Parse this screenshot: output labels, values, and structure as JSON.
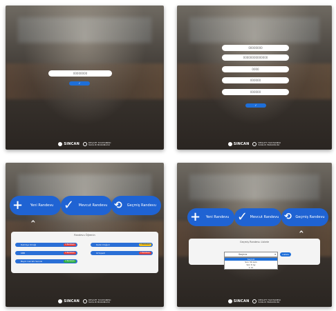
{
  "panel1": {
    "field_value": "00000000",
    "submit_label": "✓"
  },
  "panel2": {
    "fields": [
      "00000000",
      "00000000000000",
      "0000",
      "000000",
      "000000"
    ],
    "submit_label": "✓"
  },
  "panel3": {
    "new_label": "Yeni Randevu",
    "current_label": "Mevcut Randevu",
    "past_label": "Geçmiş Randevu",
    "card_title": "Randevu Öğrenin",
    "departments": [
      {
        "name": "Dahiliye Kliniği",
        "badge": "1 Randevu",
        "badge_color": "#e04040"
      },
      {
        "name": "Kadın Doğum",
        "badge": "1 Randevu",
        "badge_color": "#f0c020"
      },
      {
        "name": "KBB",
        "badge": "1 Randevu",
        "badge_color": "#e04040"
      },
      {
        "name": "Ortopedi",
        "badge": "1 Randevu",
        "badge_color": "#e04040"
      },
      {
        "name": "Beyin Cerrahi Servisi",
        "badge": "1 Randevu",
        "badge_color": "#30b040"
      }
    ]
  },
  "panel4": {
    "new_label": "Yeni Randevu",
    "current_label": "Mevcut Randevu",
    "past_label": "Geçmiş Randevu",
    "card_title": "Geçmiş Randevu Listele",
    "select_value": "Seçiniz",
    "options": [
      "Seçiniz",
      "Son 30 Gün",
      "Son 6 Ay",
      "1 Yıl"
    ],
    "go_label": "Listele"
  },
  "footer": {
    "brand": "SINCAN",
    "sub_line1": "DEVLET HASTANESI",
    "sub_line2": "SAĞLIK BAKANLIĞI"
  },
  "colors": {
    "primary_blue": "#1f63d3"
  }
}
